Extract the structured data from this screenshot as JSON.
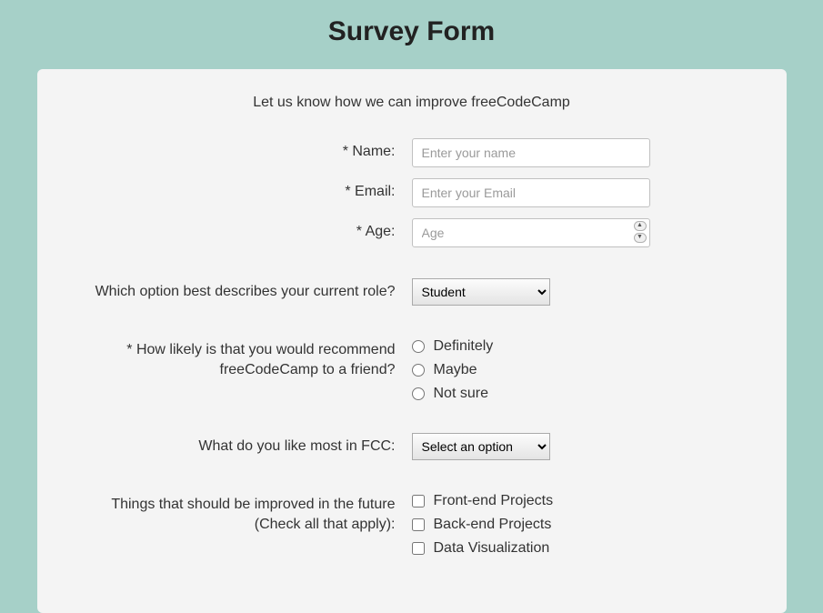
{
  "title": "Survey Form",
  "subtitle": "Let us know how we can improve freeCodeCamp",
  "fields": {
    "name": {
      "label": "* Name:",
      "placeholder": "Enter your name",
      "value": ""
    },
    "email": {
      "label": "* Email:",
      "placeholder": "Enter your Email",
      "value": ""
    },
    "age": {
      "label": "* Age:",
      "placeholder": "Age",
      "value": ""
    },
    "role": {
      "label": "Which option best describes your current role?",
      "selected": "Student",
      "options": [
        "Student"
      ]
    },
    "recommend": {
      "label": "* How likely is that you would recommend freeCodeCamp to a friend?",
      "options": [
        "Definitely",
        "Maybe",
        "Not sure"
      ]
    },
    "like_most": {
      "label": "What do you like most in FCC:",
      "selected": "Select an option",
      "options": [
        "Select an option"
      ]
    },
    "improve": {
      "label": "Things that should be improved in the future (Check all that apply):",
      "options": [
        "Front-end Projects",
        "Back-end Projects",
        "Data Visualization"
      ]
    }
  }
}
